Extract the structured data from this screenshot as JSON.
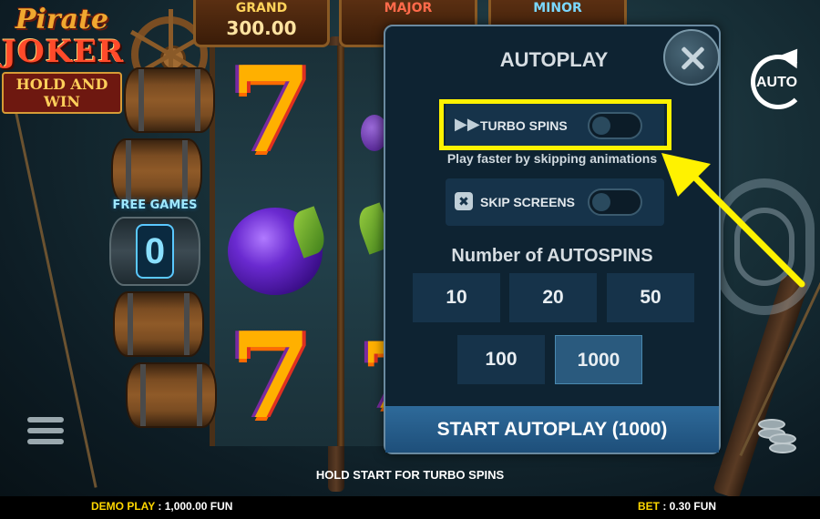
{
  "game": {
    "logo_line1": "Pirate",
    "logo_line2": "JOKER",
    "logo_line3": "HOLD AND WIN",
    "free_games_label": "FREE GAMES",
    "free_games_count": "0"
  },
  "jackpots": [
    {
      "name": "GRAND",
      "value": "300.00",
      "color": "#ffd35a"
    },
    {
      "name": "MAJOR",
      "value": "",
      "color": "#ff6a4a"
    },
    {
      "name": "MINOR",
      "value": "",
      "color": "#7ad8ff"
    }
  ],
  "autoplay": {
    "title": "AUTOPLAY",
    "turbo_label": "TURBO SPINS",
    "turbo_on": false,
    "turbo_hint": "Play faster by skipping animations",
    "skip_label": "SKIP SCREENS",
    "skip_on": false,
    "num_title": "Number of AUTOSPINS",
    "options": [
      "10",
      "20",
      "50",
      "100",
      "1000"
    ],
    "selected": "1000",
    "start_label": "START AUTOPLAY (1000)"
  },
  "controls": {
    "auto_label": "AUTO",
    "hold_text": "HOLD START FOR TURBO SPINS"
  },
  "footer": {
    "demo_label": "DEMO PLAY",
    "demo_value": ": 1,000.00 FUN",
    "bet_label": "BET",
    "bet_value": ": 0.30 FUN"
  },
  "colors": {
    "highlight": "#fff200",
    "footer_label": "#ffd800"
  }
}
